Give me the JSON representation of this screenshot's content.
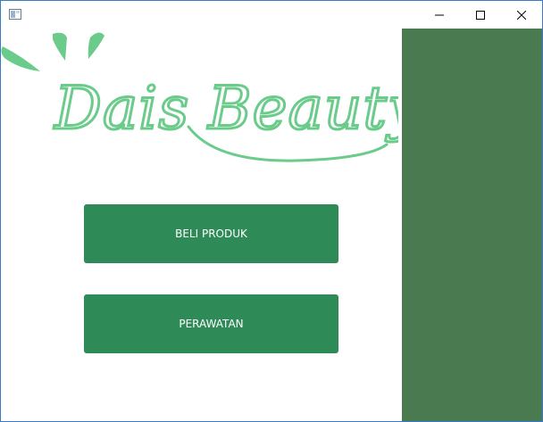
{
  "window": {
    "controls": {
      "minimize_icon": "minimize-icon",
      "maximize_icon": "maximize-icon",
      "close_icon": "close-icon"
    }
  },
  "logo": {
    "text_part1": "Dais",
    "text_part2": "Beauty",
    "color": "#6acb8a"
  },
  "menu": {
    "buy_label": "BELI PRODUK",
    "care_label": "PERAWATAN",
    "button_color": "#2e8b57"
  },
  "side_panel": {
    "color": "#4a7a50"
  }
}
